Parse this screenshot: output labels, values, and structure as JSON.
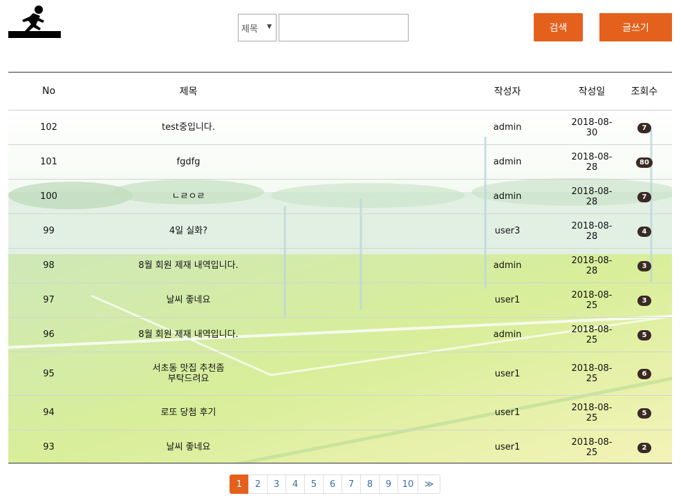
{
  "search": {
    "select_value": "제목",
    "input_value": "",
    "search_label": "검색",
    "write_label": "글쓰기"
  },
  "table": {
    "headers": {
      "no": "No",
      "title": "제목",
      "writer": "작성자",
      "date": "작성일",
      "views": "조회수"
    },
    "rows": [
      {
        "no": "102",
        "title": "test중입니다.",
        "writer": "admin",
        "date": "2018-08-30",
        "views": "7"
      },
      {
        "no": "101",
        "title": "fgdfg",
        "writer": "admin",
        "date": "2018-08-28",
        "views": "80"
      },
      {
        "no": "100",
        "title": "ㄴㄹㅇㄹ",
        "writer": "admin",
        "date": "2018-08-28",
        "views": "7"
      },
      {
        "no": "99",
        "title": "4일 실화?",
        "writer": "user3",
        "date": "2018-08-28",
        "views": "4"
      },
      {
        "no": "98",
        "title": "8월 회원 제재 내역입니다.",
        "writer": "admin",
        "date": "2018-08-28",
        "views": "3"
      },
      {
        "no": "97",
        "title": "날씨 좋네요",
        "writer": "user1",
        "date": "2018-08-25",
        "views": "3"
      },
      {
        "no": "96",
        "title": "8월 회원 제재 내역입니다.",
        "writer": "admin",
        "date": "2018-08-25",
        "views": "5"
      },
      {
        "no": "95",
        "title": "서초동 맛집 추천좀\n부탁드려요",
        "writer": "user1",
        "date": "2018-08-25",
        "views": "6"
      },
      {
        "no": "94",
        "title": "로또 당첨 후기",
        "writer": "user1",
        "date": "2018-08-25",
        "views": "5"
      },
      {
        "no": "93",
        "title": "날씨 좋네요",
        "writer": "user1",
        "date": "2018-08-25",
        "views": "2"
      }
    ]
  },
  "pagination": {
    "pages": [
      "1",
      "2",
      "3",
      "4",
      "5",
      "6",
      "7",
      "8",
      "9",
      "10"
    ],
    "active": "1",
    "next_label": "≫"
  },
  "colors": {
    "accent": "#e4611d",
    "badge": "#3a2a24",
    "link": "#3a6ea5"
  },
  "icons": {
    "logo": "runner-logo-icon",
    "select_arrow": "triangle-down-icon"
  }
}
